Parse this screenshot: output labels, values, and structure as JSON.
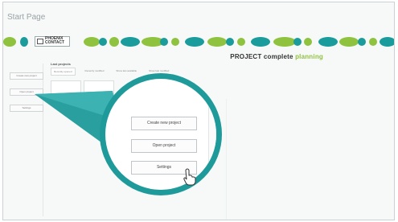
{
  "window": {
    "title": "Start Page"
  },
  "banner": {
    "logo_text": "PHOENIX CONTACT",
    "brand_main": "PROJECT complete",
    "brand_accent": "planning",
    "colors": {
      "green": "#8fc23f",
      "teal": "#1a9b9c"
    }
  },
  "sidebar": {
    "items": [
      {
        "label": "Create new project"
      },
      {
        "label": "Open project"
      },
      {
        "label": "Settings"
      }
    ]
  },
  "main": {
    "section_label": "Last projects",
    "tabs": [
      {
        "label": "Recently opened"
      },
      {
        "label": "Recently modified"
      },
      {
        "label": "Show last available"
      },
      {
        "label": "Show last modified"
      }
    ]
  },
  "zoom": {
    "buttons": [
      {
        "label": "Create new project"
      },
      {
        "label": "Open project"
      },
      {
        "label": "Settings"
      }
    ],
    "accent_color": "#1f9a9a",
    "cursor_icon": "pointer-hand-icon"
  }
}
